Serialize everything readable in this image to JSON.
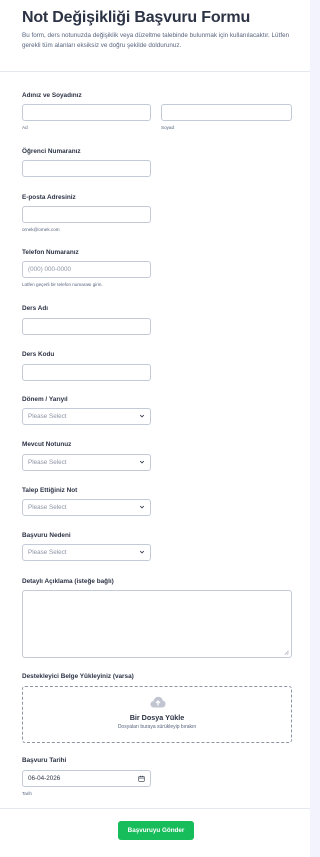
{
  "form": {
    "title": "Not Değişikliği Başvuru Formu",
    "description": "Bu form, ders notunuzda değişiklik veya düzeltme talebinde bulunmak için kullanılacaktır. Lütfen gerekli tüm alanları eksiksiz ve doğru şekilde doldurunuz."
  },
  "fields": {
    "name": {
      "label": "Adınız ve Soyadınız",
      "first_placeholder": "",
      "last_placeholder": "",
      "first_sub": "Ad",
      "last_sub": "Soyad"
    },
    "student_no": {
      "label": "Öğrenci Numaranız",
      "value": ""
    },
    "email": {
      "label": "E-posta Adresiniz",
      "value": "",
      "sub": "ornek@ornek.com"
    },
    "phone": {
      "label": "Telefon Numaranız",
      "placeholder": "(000) 000-0000",
      "sub": "Lütfen geçerli bir telefon numarası girin."
    },
    "course_name": {
      "label": "Ders Adı",
      "value": ""
    },
    "course_code": {
      "label": "Ders Kodu",
      "value": ""
    },
    "term": {
      "label": "Dönem / Yarıyıl",
      "selected": "Please Select"
    },
    "current_grade": {
      "label": "Mevcut Notunuz",
      "selected": "Please Select"
    },
    "requested_grade": {
      "label": "Talep Ettiğiniz Not",
      "selected": "Please Select"
    },
    "reason": {
      "label": "Başvuru Nedeni",
      "selected": "Please Select"
    },
    "details": {
      "label": "Detaylı Açıklama (isteğe bağlı)",
      "value": ""
    },
    "upload": {
      "label": "Destekleyici Belge Yükleyiniz (varsa)",
      "title": "Bir Dosya Yükle",
      "sub": "Dosyaları buraya sürükleyip bırakın"
    },
    "date": {
      "label": "Başvuru Tarihi",
      "value": "06-04-2026",
      "sub": "Tarih"
    }
  },
  "submit": {
    "label": "Başvuruyu Gönder"
  },
  "colors": {
    "accent": "#18bd5b",
    "border": "#c3cad8",
    "text": "#2c3345",
    "muted": "#57647e"
  },
  "icons": {
    "select": "chevron-down-icon",
    "upload": "cloud-upload-icon",
    "date": "calendar-icon"
  }
}
